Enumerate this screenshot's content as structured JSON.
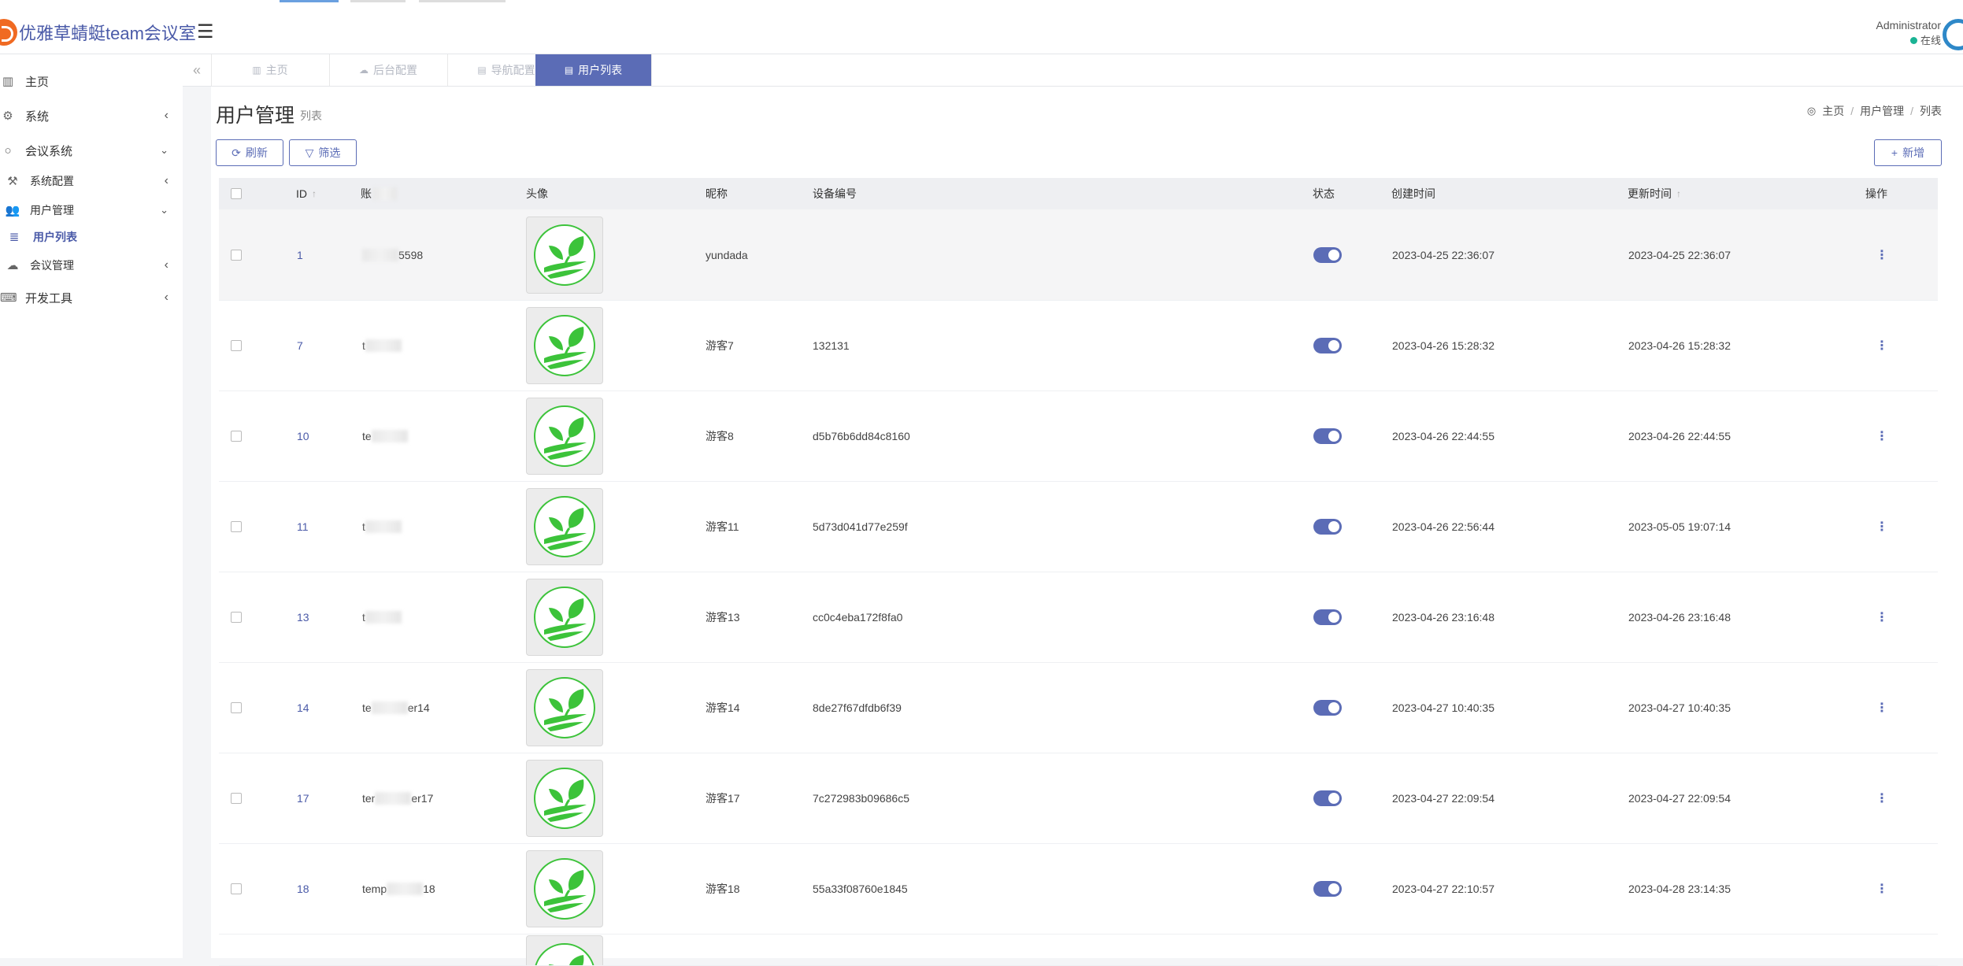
{
  "app": {
    "title": "优雅草蜻蜓team会议室",
    "user": {
      "name": "Administrator",
      "status": "在线"
    }
  },
  "sidebar": {
    "items": [
      {
        "label": "主页",
        "icon": "chart-icon"
      },
      {
        "label": "系统",
        "icon": "gear-icon"
      },
      {
        "label": "会议系统",
        "icon": "circle-icon"
      },
      {
        "label": "系统配置",
        "icon": "wrench-icon"
      },
      {
        "label": "用户管理",
        "icon": "users-icon"
      },
      {
        "label": "用户列表",
        "icon": "list-icon"
      },
      {
        "label": "会议管理",
        "icon": "cloud-icon"
      },
      {
        "label": "开发工具",
        "icon": "keyboard-icon"
      }
    ]
  },
  "tabs": [
    {
      "label": "主页",
      "icon": "chart-icon"
    },
    {
      "label": "后台配置",
      "icon": "cloud-icon"
    },
    {
      "label": "导航配置",
      "icon": "list-icon"
    },
    {
      "label": "用户列表",
      "icon": "list-icon"
    }
  ],
  "page": {
    "title": "用户管理",
    "subtitle": "列表",
    "breadcrumb": [
      "主页",
      "用户管理",
      "列表"
    ],
    "refresh_label": "刷新",
    "filter_label": "筛选",
    "add_label": "新增"
  },
  "table": {
    "columns": [
      "ID",
      "账",
      "头像",
      "昵称",
      "设备编号",
      "状态",
      "创建时间",
      "更新时间",
      "操作"
    ],
    "rows": [
      {
        "id": "1",
        "account_visible": "",
        "account_tail": "5598",
        "nickname": "yundada",
        "device": "",
        "created": "2023-04-25 22:36:07",
        "updated": "2023-04-25 22:36:07",
        "enabled": true
      },
      {
        "id": "7",
        "account_visible": "t",
        "account_tail": "",
        "nickname": "游客7",
        "device": "132131",
        "created": "2023-04-26 15:28:32",
        "updated": "2023-04-26 15:28:32",
        "enabled": true
      },
      {
        "id": "10",
        "account_visible": "te",
        "account_tail": "",
        "nickname": "游客8",
        "device": "d5b76b6dd84c8160",
        "created": "2023-04-26 22:44:55",
        "updated": "2023-04-26 22:44:55",
        "enabled": true
      },
      {
        "id": "11",
        "account_visible": "t",
        "account_tail": "",
        "nickname": "游客11",
        "device": "5d73d041d77e259f",
        "created": "2023-04-26 22:56:44",
        "updated": "2023-05-05 19:07:14",
        "enabled": true
      },
      {
        "id": "13",
        "account_visible": "t",
        "account_tail": "",
        "nickname": "游客13",
        "device": "cc0c4eba172f8fa0",
        "created": "2023-04-26 23:16:48",
        "updated": "2023-04-26 23:16:48",
        "enabled": true
      },
      {
        "id": "14",
        "account_visible": "te",
        "account_tail": "er14",
        "nickname": "游客14",
        "device": "8de27f67dfdb6f39",
        "created": "2023-04-27 10:40:35",
        "updated": "2023-04-27 10:40:35",
        "enabled": true
      },
      {
        "id": "17",
        "account_visible": "ter",
        "account_tail": "er17",
        "nickname": "游客17",
        "device": "7c272983b09686c5",
        "created": "2023-04-27 22:09:54",
        "updated": "2023-04-27 22:09:54",
        "enabled": true
      },
      {
        "id": "18",
        "account_visible": "temp",
        "account_tail": "18",
        "nickname": "游客18",
        "device": "55a33f08760e1845",
        "created": "2023-04-27 22:10:57",
        "updated": "2023-04-28 23:14:35",
        "enabled": true
      }
    ]
  },
  "colors": {
    "accent": "#5b6cb6",
    "brand_orange": "#f06a22",
    "leaf_green": "#3cc33a",
    "online": "#1ab394"
  }
}
